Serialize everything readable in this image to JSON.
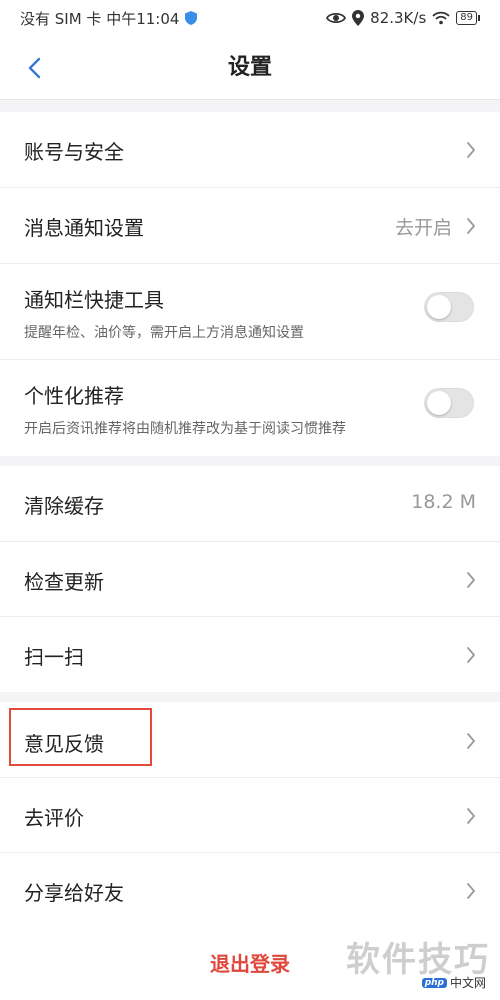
{
  "status_bar": {
    "carrier": "没有 SIM 卡 中午11:04",
    "net_speed": "82.3K/s",
    "battery": "89",
    "icons": [
      "shield-icon",
      "eye-icon",
      "location-icon",
      "wifi-icon",
      "battery-icon"
    ]
  },
  "nav": {
    "title": "设置",
    "back_icon": "chevron-left-icon"
  },
  "sections": [
    {
      "items": [
        {
          "title": "账号与安全",
          "type": "link"
        },
        {
          "title": "消息通知设置",
          "value": "去开启",
          "type": "link"
        },
        {
          "title": "通知栏快捷工具",
          "subtitle": "提醒年检、油价等，需开启上方消息通知设置",
          "type": "toggle",
          "on": false
        },
        {
          "title": "个性化推荐",
          "subtitle": "开启后资讯推荐将由随机推荐改为基于阅读习惯推荐",
          "type": "toggle",
          "on": false
        }
      ]
    },
    {
      "items": [
        {
          "title": "清除缓存",
          "value": "18.2 M",
          "type": "value"
        },
        {
          "title": "检查更新",
          "type": "link"
        },
        {
          "title": "扫一扫",
          "type": "link"
        }
      ]
    },
    {
      "items": [
        {
          "title": "意见反馈",
          "type": "link",
          "highlighted": true
        },
        {
          "title": "去评价",
          "type": "link"
        },
        {
          "title": "分享给好友",
          "type": "link"
        }
      ]
    }
  ],
  "logout": {
    "label": "退出登录",
    "color": "#e0483b"
  },
  "watermark": {
    "main": "软件技巧",
    "badge": "php",
    "sub": "中文网"
  },
  "colors": {
    "accent": "#3a78d8",
    "highlight_border": "#e24a3b",
    "toggle_off": "#e4e4e4"
  }
}
